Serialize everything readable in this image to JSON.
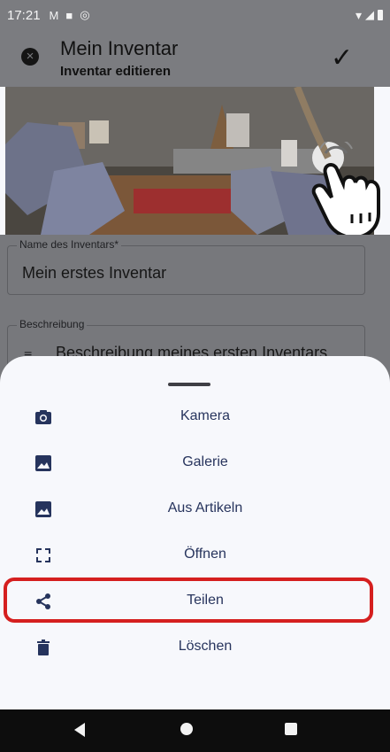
{
  "status_bar": {
    "time": "17:21",
    "notification_icons": [
      "M",
      "■",
      "◎"
    ],
    "right_icons": [
      "wifi-icon",
      "signal-icon",
      "battery-icon"
    ]
  },
  "app_bar": {
    "close_icon": "close-circle-icon",
    "title": "Mein Inventar",
    "subtitle": "Inventar editieren",
    "check_icon": "check-icon"
  },
  "form": {
    "name_label": "Name des Inventars*",
    "name_value": "Mein erstes Inventar",
    "description_label": "Beschreibung",
    "description_value": "Beschreibung meines ersten Inventars"
  },
  "bottom_sheet": {
    "items": [
      {
        "label": "Kamera",
        "icon": "camera-icon"
      },
      {
        "label": "Galerie",
        "icon": "image-icon"
      },
      {
        "label": "Aus Artikeln",
        "icon": "image-icon"
      },
      {
        "label": "Öffnen",
        "icon": "expand-icon"
      },
      {
        "label": "Teilen",
        "icon": "share-icon"
      },
      {
        "label": "Löschen",
        "icon": "trash-icon"
      }
    ],
    "highlighted_item": "Teilen",
    "highlight_color": "#d51f1f"
  },
  "navigation_bar": {
    "buttons": [
      "back-icon",
      "home-icon",
      "recent-apps-icon"
    ]
  },
  "colors": {
    "primary_text": "#27345d",
    "scrim": "#7b7c80"
  }
}
